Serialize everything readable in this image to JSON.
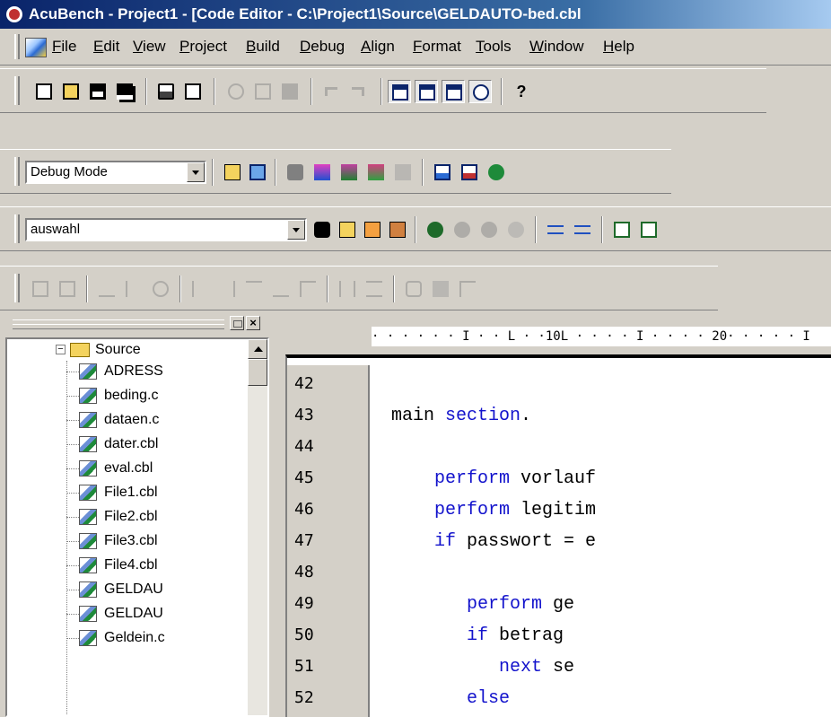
{
  "window": {
    "title": "AcuBench - Project1 - [Code Editor - C:\\Project1\\Source\\GELDAUTO-bed.cbl"
  },
  "menu": {
    "items": [
      "File",
      "Edit",
      "View",
      "Project",
      "Build",
      "Debug",
      "Align",
      "Format",
      "Tools",
      "Window",
      "Help"
    ]
  },
  "toolbar_debug": {
    "mode_value": "Debug Mode"
  },
  "toolbar_para": {
    "value": "auswahl"
  },
  "ruler": {
    "text": "· · · · · · I · · L · ·10L · · · · I · · · · 20· · · · · I"
  },
  "tree": {
    "folder": "Source",
    "files": [
      "ADRESS",
      "beding.c",
      "dataen.c",
      "dater.cbl",
      "eval.cbl",
      "File1.cbl",
      "File2.cbl",
      "File3.cbl",
      "File4.cbl",
      "GELDAU",
      "GELDAU",
      "Geldein.c"
    ]
  },
  "code": {
    "lines": [
      {
        "n": "42",
        "text": ""
      },
      {
        "n": "43",
        "plain1": "main ",
        "kw1": "section",
        "plain2": ".",
        "indent": 0
      },
      {
        "n": "44",
        "text": ""
      },
      {
        "n": "45",
        "kw1": "perform",
        "plain2": " vorlauf",
        "indent": 4
      },
      {
        "n": "46",
        "kw1": "perform",
        "plain2": " legitim",
        "indent": 4
      },
      {
        "n": "47",
        "kw1": "if",
        "plain2": " passwort = e",
        "indent": 4
      },
      {
        "n": "48",
        "text": ""
      },
      {
        "n": "49",
        "kw1": "perform",
        "plain2": " ge",
        "indent": 7
      },
      {
        "n": "50",
        "kw1": "if",
        "plain2": " betrag",
        "indent": 7
      },
      {
        "n": "51",
        "kw1": "next",
        "plain2": " se",
        "indent": 10
      },
      {
        "n": "52",
        "kw1": "else",
        "plain2": "",
        "indent": 7
      }
    ]
  },
  "colors": {
    "keyword": "#1212cc",
    "titlebar": "#0a246a",
    "chrome": "#d4d0c8"
  }
}
